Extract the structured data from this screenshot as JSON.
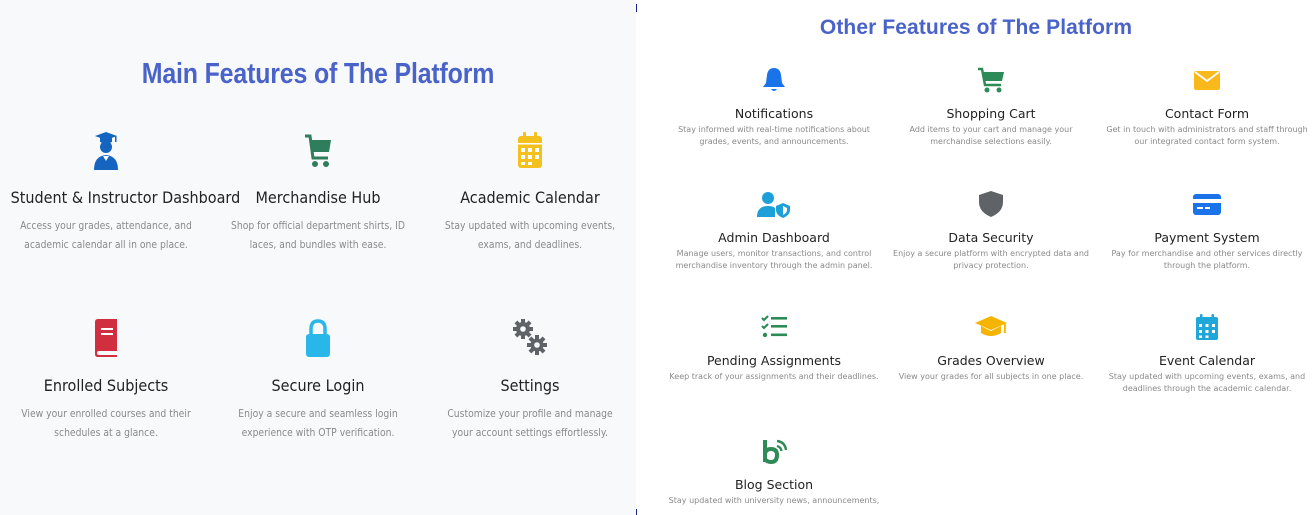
{
  "main": {
    "title": "Main Features of The Platform",
    "features": [
      {
        "name": "Student & Instructor Dashboard",
        "desc": "Access your grades, attendance, and academic calendar all in one place.",
        "icon": "graduate-user-icon",
        "color": "#1565c0"
      },
      {
        "name": "Merchandise Hub",
        "desc": "Shop for official department shirts, ID laces, and bundles with ease.",
        "icon": "shopping-cart-icon",
        "color": "#2e7d5b"
      },
      {
        "name": "Academic Calendar",
        "desc": "Stay updated with upcoming events, exams, and deadlines.",
        "icon": "calendar-icon",
        "color": "#f4c01e"
      },
      {
        "name": "Enrolled Subjects",
        "desc": "View your enrolled courses and their schedules at a glance.",
        "icon": "book-icon",
        "color": "#d12f3f"
      },
      {
        "name": "Secure Login",
        "desc": "Enjoy a secure and seamless login experience with OTP verification.",
        "icon": "lock-icon",
        "color": "#29b6e8"
      },
      {
        "name": "Settings",
        "desc": "Customize your profile and manage your account settings effortlessly.",
        "icon": "gears-icon",
        "color": "#5f6368"
      }
    ]
  },
  "other": {
    "title": "Other Features of The Platform",
    "features": [
      {
        "name": "Notifications",
        "desc": "Stay informed with real-time notifications about grades, events, and announcements.",
        "icon": "bell-icon",
        "color": "#1a73e8"
      },
      {
        "name": "Shopping Cart",
        "desc": "Add items to your cart and manage your merchandise selections easily.",
        "icon": "shopping-cart-icon",
        "color": "#2e8b57"
      },
      {
        "name": "Contact Form",
        "desc": "Get in touch with administrators and staff through our integrated contact form system.",
        "icon": "envelope-icon",
        "color": "#f9b81b"
      },
      {
        "name": "Admin Dashboard",
        "desc": "Manage users, monitor transactions, and control merchandise inventory through the admin panel.",
        "icon": "user-shield-icon",
        "color": "#1e9fd8"
      },
      {
        "name": "Data Security",
        "desc": "Enjoy a secure platform with encrypted data and privacy protection.",
        "icon": "shield-icon",
        "color": "#5f6368"
      },
      {
        "name": "Payment System",
        "desc": "Pay for merchandise and other services directly through the platform.",
        "icon": "credit-card-icon",
        "color": "#1a73e8"
      },
      {
        "name": "Pending Assignments",
        "desc": "Keep track of your assignments and their deadlines.",
        "icon": "task-list-icon",
        "color": "#2e8b57"
      },
      {
        "name": "Grades Overview",
        "desc": "View your grades for all subjects in one place.",
        "icon": "graduation-cap-icon",
        "color": "#f4b400"
      },
      {
        "name": "Event Calendar",
        "desc": "Stay updated with upcoming events, exams, and deadlines through the academic calendar.",
        "icon": "calendar-icon",
        "color": "#1ea7d8"
      },
      {
        "name": "Blog Section",
        "desc": "Stay updated with university news, announcements,",
        "icon": "blog-icon",
        "color": "#2e8b57"
      }
    ]
  }
}
